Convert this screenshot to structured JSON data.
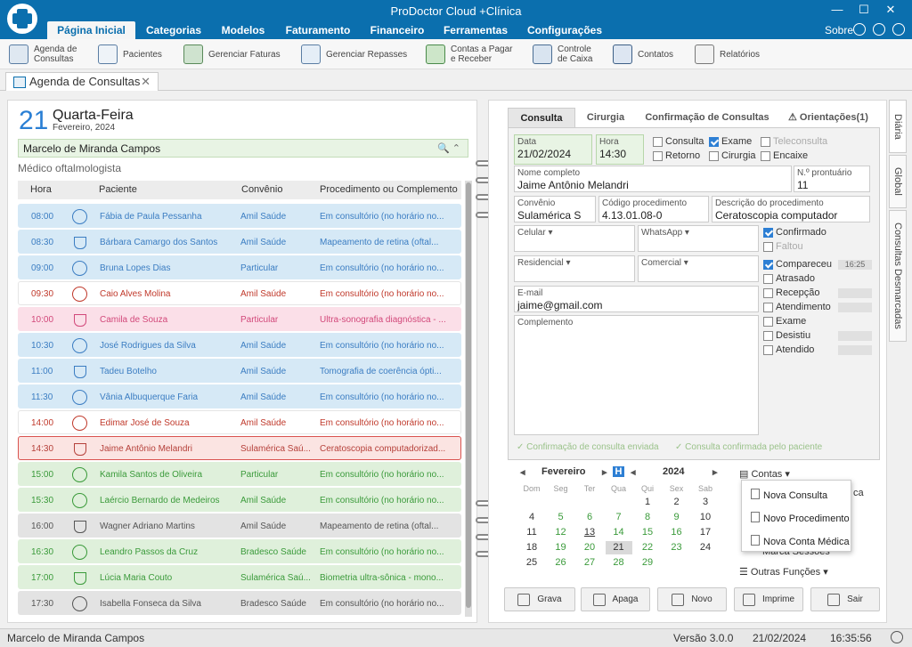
{
  "app": {
    "title": "ProDoctor Cloud +Clínica"
  },
  "menu": {
    "tabs": [
      "Página Inicial",
      "Categorias",
      "Modelos",
      "Faturamento",
      "Financeiro",
      "Ferramentas",
      "Configurações"
    ],
    "sobre": "Sobre"
  },
  "ribbon": {
    "items": [
      "Agenda de Consultas",
      "Pacientes",
      "Gerenciar Faturas",
      "Gerenciar Repasses",
      "Contas a Pagar e Receber",
      "Controle de Caixa",
      "Contatos",
      "Relatórios"
    ]
  },
  "doctab": {
    "label": "Agenda de Consultas"
  },
  "agenda": {
    "day_number": "21",
    "day_name": "Quarta-Feira",
    "month_year": "Fevereiro, 2024",
    "doctor": "Marcelo de Miranda Campos",
    "specialty": "Médico oftalmologista",
    "columns": [
      "Hora",
      "Paciente",
      "Convênio",
      "Procedimento ou Complemento"
    ],
    "rows": [
      {
        "hora": "08:00",
        "paciente": "Fábia de Paula Pessanha",
        "convenio": "Amil Saúde",
        "proc": "Em consultório (no horário no...",
        "status": "blue",
        "icon": "smiley"
      },
      {
        "hora": "08:30",
        "paciente": "Bárbara Camargo dos Santos",
        "convenio": "Amil Saúde",
        "proc": "Mapeamento de retina (oftal...",
        "status": "blue",
        "icon": "flask"
      },
      {
        "hora": "09:00",
        "paciente": "Bruna Lopes Dias",
        "convenio": "Particular",
        "proc": "Em consultório (no horário no...",
        "status": "blue",
        "icon": "smiley"
      },
      {
        "hora": "09:30",
        "paciente": "Caio Alves Molina",
        "convenio": "Amil Saúde",
        "proc": "Em consultório (no horário no...",
        "status": "white",
        "icon": "smiley-red"
      },
      {
        "hora": "10:00",
        "paciente": "Camila de Souza",
        "convenio": "Particular",
        "proc": "Ultra-sonografia diagnóstica - ...",
        "status": "pink",
        "icon": "flask"
      },
      {
        "hora": "10:30",
        "paciente": "José Rodrigues da Silva",
        "convenio": "Amil Saúde",
        "proc": "Em consultório (no horário no...",
        "status": "blue",
        "icon": "smiley"
      },
      {
        "hora": "11:00",
        "paciente": "Tadeu Botelho",
        "convenio": "Amil Saúde",
        "proc": "Tomografia de coerência ópti...",
        "status": "blue",
        "icon": "flask"
      },
      {
        "hora": "11:30",
        "paciente": "Vânia Albuquerque Faria",
        "convenio": "Amil Saúde",
        "proc": "Em consultório (no horário no...",
        "status": "blue",
        "icon": "smiley"
      },
      {
        "hora": "14:00",
        "paciente": "Edimar José de Souza",
        "convenio": "Amil Saúde",
        "proc": "Em consultório (no horário no...",
        "status": "white",
        "icon": "smiley-red"
      },
      {
        "hora": "14:30",
        "paciente": "Jaime Antônio Melandri",
        "convenio": "Sulamérica Saú...",
        "proc": "Ceratoscopia computadorizad...",
        "status": "selected",
        "icon": "flask"
      },
      {
        "hora": "15:00",
        "paciente": "Kamila Santos de Oliveira",
        "convenio": "Particular",
        "proc": "Em consultório (no horário no...",
        "status": "green",
        "icon": "smiley"
      },
      {
        "hora": "15:30",
        "paciente": "Laércio Bernardo de Medeiros",
        "convenio": "Amil Saúde",
        "proc": "Em consultório (no horário no...",
        "status": "green",
        "icon": "smiley"
      },
      {
        "hora": "16:00",
        "paciente": "Wagner Adriano Martins",
        "convenio": "Amil Saúde",
        "proc": "Mapeamento de retina (oftal...",
        "status": "gray",
        "icon": "flask"
      },
      {
        "hora": "16:30",
        "paciente": "Leandro Passos da Cruz",
        "convenio": "Bradesco Saúde",
        "proc": "Em consultório (no horário no...",
        "status": "green",
        "icon": "smiley"
      },
      {
        "hora": "17:00",
        "paciente": "Lúcia Maria Couto",
        "convenio": "Sulamérica Saú...",
        "proc": "Biometria ultra-sônica - mono...",
        "status": "green",
        "icon": "flask"
      },
      {
        "hora": "17:30",
        "paciente": "Isabella Fonseca da Silva",
        "convenio": "Bradesco Saúde",
        "proc": "Em consultório (no horário no...",
        "status": "gray",
        "icon": "smiley"
      }
    ]
  },
  "detail": {
    "tabs": [
      "Consulta",
      "Cirurgia",
      "Confirmação de Consultas",
      "⚠ Orientações(1)"
    ],
    "data_label": "Data",
    "data_value": "21/02/2024",
    "hora_label": "Hora",
    "hora_value": "14:30",
    "tipo": {
      "consulta": "Consulta",
      "exame": "Exame",
      "teleconsulta": "Teleconsulta",
      "retorno": "Retorno",
      "cirurgia": "Cirurgia",
      "encaixe": "Encaixe"
    },
    "nome_label": "Nome completo",
    "nome_value": "Jaime Antônio Melandri",
    "pront_label": "N.º prontuário",
    "pront_value": "11",
    "conv_label": "Convênio",
    "conv_value": "Sulamérica S",
    "codproc_label": "Código procedimento",
    "codproc_value": "4.13.01.08-0",
    "descproc_label": "Descrição do procedimento",
    "descproc_value": "Ceratoscopia computador",
    "celular": "Celular ▾",
    "whatsapp": "WhatsApp ▾",
    "residencial": "Residencial ▾",
    "comercial": "Comercial ▾",
    "email_label": "E-mail",
    "email_value": "jaime@gmail.com",
    "complemento_label": "Complemento",
    "status": {
      "confirmado": "Confirmado",
      "faltou": "Faltou",
      "compareceu": "Compareceu",
      "compareceu_time": "16:25",
      "atrasado": "Atrasado",
      "recepcao": "Recepção",
      "atendimento": "Atendimento",
      "exame": "Exame",
      "desistiu": "Desistiu",
      "atendido": "Atendido"
    },
    "conf_enviada": "Confirmação de consulta enviada",
    "conf_paciente": "Consulta confirmada pelo paciente"
  },
  "calendar": {
    "month": "Fevereiro",
    "year": "2024",
    "h_label": "H",
    "dow": [
      "Dom",
      "Seg",
      "Ter",
      "Qua",
      "Qui",
      "Sex",
      "Sab"
    ],
    "weeks": [
      [
        "",
        "",
        "",
        "",
        "1",
        "2",
        "3"
      ],
      [
        "4",
        "5",
        "6",
        "7",
        "8",
        "9",
        "10"
      ],
      [
        "11",
        "12",
        "13",
        "14",
        "15",
        "16",
        "17"
      ],
      [
        "18",
        "19",
        "20",
        "21",
        "22",
        "23",
        "24"
      ],
      [
        "25",
        "26",
        "27",
        "28",
        "29",
        "",
        ""
      ]
    ]
  },
  "side": {
    "contas": "Contas ▾",
    "marca": "Marca Sessões",
    "outras": "Outras Funções ▾",
    "hidden": "ca"
  },
  "popup": {
    "items": [
      "Nova Consulta",
      "Novo Procedimento",
      "Nova Conta Médica"
    ]
  },
  "buttons": {
    "grava": "Grava",
    "apaga": "Apaga",
    "novo": "Novo",
    "imprime": "Imprime",
    "sair": "Sair"
  },
  "vtabs": [
    "Diária",
    "Global",
    "Consultas Desmarcadas"
  ],
  "status_bar": {
    "user": "Marcelo de Miranda Campos",
    "version": "Versão 3.0.0",
    "date": "21/02/2024",
    "time": "16:35:56"
  },
  "colors": {
    "blue": "#d6e9f6",
    "green": "#dff0db",
    "pink": "#fbdfe8",
    "gray": "#e3e3e3",
    "white": "#ffffff",
    "selected": "#fbe4e2",
    "accent": "#0b6fae"
  }
}
